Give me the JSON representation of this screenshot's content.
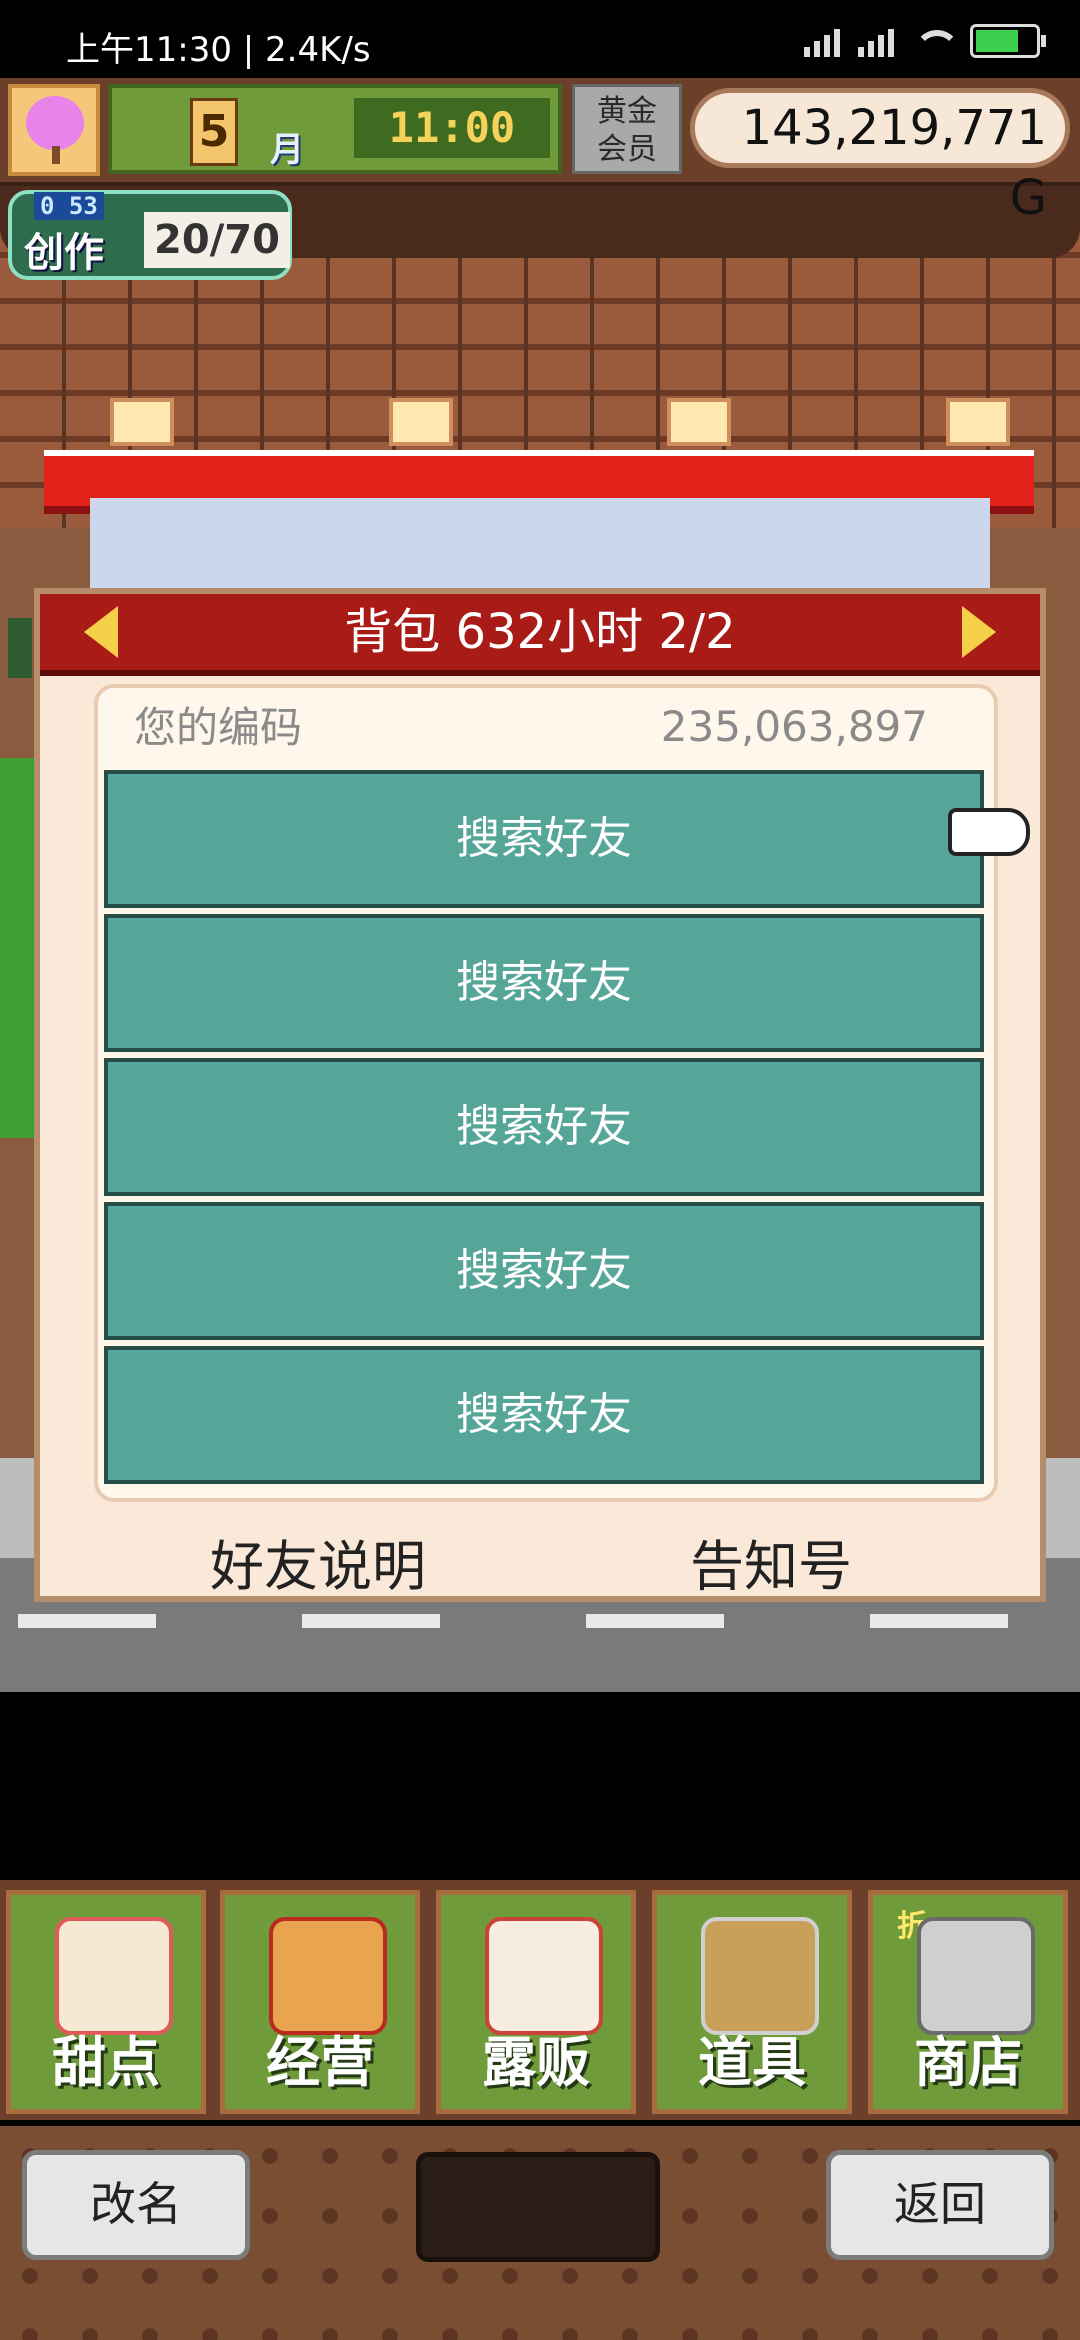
{
  "status_bar": {
    "time": "上午11:30 | 2.4K/s",
    "icons": [
      "hd-signal-icon",
      "hd-signal-icon",
      "wifi-icon",
      "battery-charging-icon"
    ]
  },
  "hud": {
    "month_number": "5",
    "month_char": "月",
    "clock": "11:00",
    "gold_member_line1": "黄金",
    "gold_member_line2": "会员",
    "money": "143,219,771 G",
    "create_small": "0 53",
    "create_label": "创作",
    "create_count": "20/70"
  },
  "dialog": {
    "title": "背包 632小时 2/2",
    "code_label": "您的编码",
    "code_value": "235,063,897",
    "friend_buttons": [
      "搜索好友",
      "搜索好友",
      "搜索好友",
      "搜索好友",
      "搜索好友"
    ],
    "footer_left": "好友说明",
    "footer_right": "告知号"
  },
  "menu": {
    "items": [
      {
        "label": "甜点",
        "icon": "cake-icon"
      },
      {
        "label": "经营",
        "icon": "shop-icon"
      },
      {
        "label": "露贩",
        "icon": "food-truck-icon"
      },
      {
        "label": "道具",
        "icon": "item-bag-icon"
      },
      {
        "label": "商店",
        "icon": "shopping-cart-icon"
      }
    ],
    "sale_tag": "折"
  },
  "bottom": {
    "rename": "改名",
    "return": "返回"
  },
  "colors": {
    "dialog_title_bg": "#a81b16",
    "friend_button_bg": "#55a699",
    "menu_bg": "#6f9b3a"
  }
}
